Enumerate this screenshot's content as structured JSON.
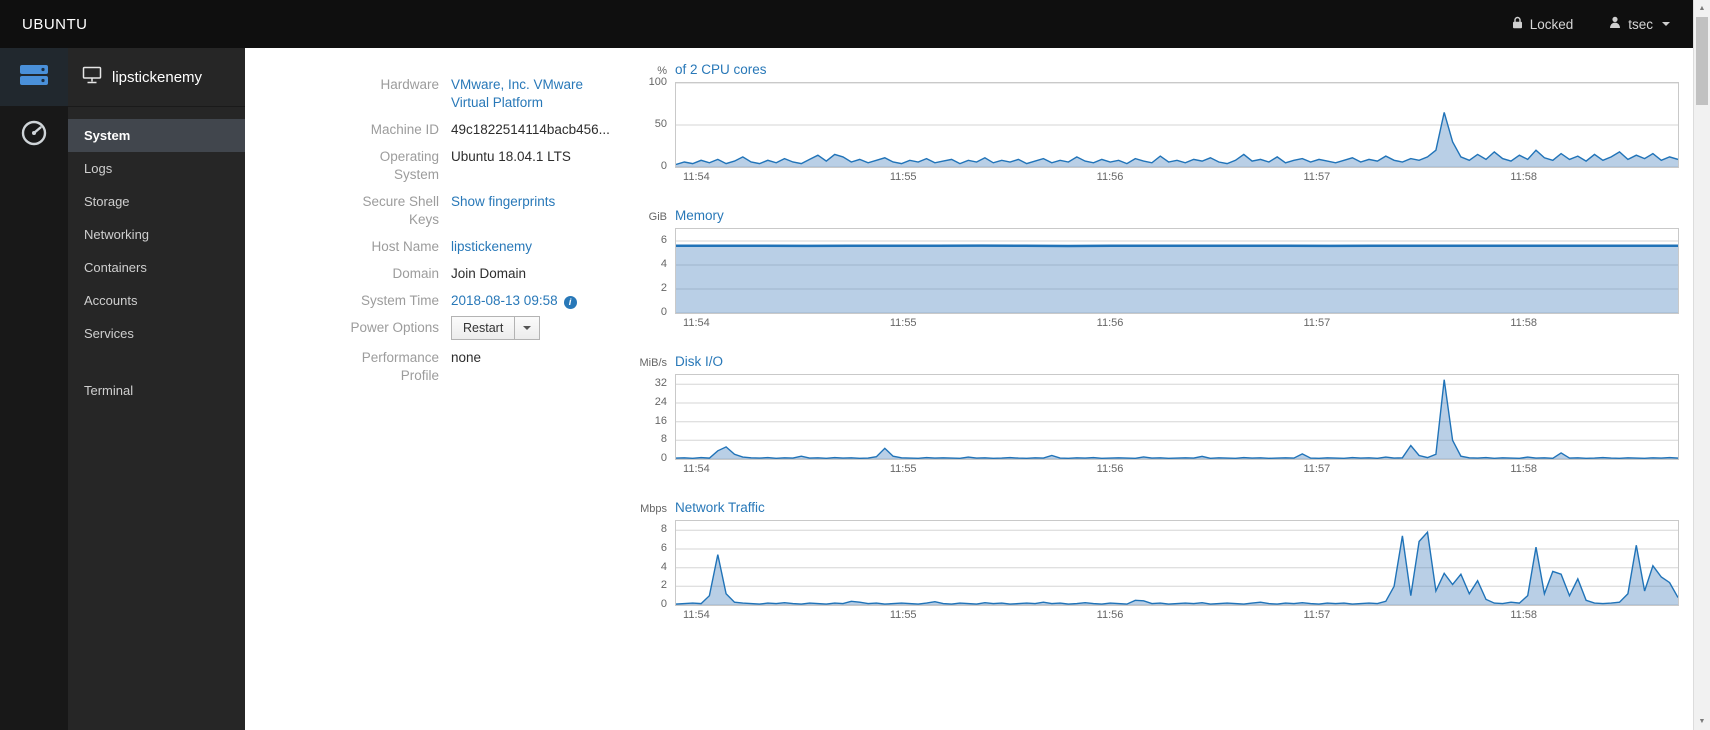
{
  "topbar": {
    "brand": "UBUNTU",
    "locked_label": "Locked",
    "user": "tsec"
  },
  "sidebar": {
    "host": "lipstickenemy",
    "items": [
      {
        "label": "System",
        "active": true
      },
      {
        "label": "Logs",
        "active": false
      },
      {
        "label": "Storage",
        "active": false
      },
      {
        "label": "Networking",
        "active": false
      },
      {
        "label": "Containers",
        "active": false
      },
      {
        "label": "Accounts",
        "active": false
      },
      {
        "label": "Services",
        "active": false
      },
      {
        "label": "Terminal",
        "active": false
      }
    ]
  },
  "system_info": {
    "fields": [
      {
        "label": "Hardware",
        "value": "VMware, Inc. VMware Virtual Platform"
      },
      {
        "label": "Machine ID",
        "value": "49c1822514114bacb456..."
      },
      {
        "label": "Operating System",
        "value": "Ubuntu 18.04.1 LTS"
      },
      {
        "label": "Secure Shell Keys",
        "value": "Show fingerprints"
      },
      {
        "label": "Host Name",
        "value": "lipstickenemy"
      },
      {
        "label": "Domain",
        "value": "Join Domain"
      },
      {
        "label": "System Time",
        "value": "2018-08-13 09:58"
      },
      {
        "label": "Power Options",
        "value": "Restart"
      },
      {
        "label": "Performance Profile",
        "value": "none"
      }
    ]
  },
  "colors": {
    "accent": "#2878b8",
    "chart_line": "#2073b8",
    "chart_fill": "rgba(70,130,190,0.38)",
    "sidebar_active_bg": "#41464d",
    "topbar_bg": "#0f0f0f"
  },
  "chart_data": [
    {
      "type": "area",
      "unit": "%",
      "title": "of 2 CPU cores",
      "ymax": 100,
      "yticks": [
        0,
        50,
        100
      ],
      "xticks": [
        "11:54",
        "11:55",
        "11:56",
        "11:57",
        "11:58"
      ],
      "xtick_pos": [
        0.008,
        0.214,
        0.42,
        0.626,
        0.832
      ],
      "line_width": 1.4,
      "values": [
        3,
        6,
        4,
        8,
        5,
        9,
        4,
        7,
        12,
        6,
        4,
        8,
        5,
        10,
        6,
        4,
        9,
        14,
        7,
        15,
        12,
        6,
        9,
        5,
        8,
        11,
        6,
        4,
        8,
        6,
        10,
        5,
        7,
        9,
        4,
        8,
        6,
        11,
        5,
        8,
        6,
        9,
        4,
        7,
        10,
        5,
        8,
        6,
        12,
        7,
        5,
        9,
        6,
        8,
        4,
        10,
        7,
        5,
        13,
        6,
        8,
        5,
        9,
        7,
        11,
        6,
        4,
        8,
        15,
        7,
        9,
        6,
        12,
        5,
        8,
        10,
        6,
        9,
        7,
        5,
        8,
        11,
        6,
        9,
        7,
        13,
        8,
        6,
        10,
        8,
        12,
        20,
        65,
        30,
        12,
        8,
        15,
        9,
        18,
        10,
        7,
        14,
        9,
        20,
        11,
        8,
        16,
        9,
        13,
        7,
        15,
        8,
        12,
        18,
        9,
        14,
        10,
        16,
        8,
        12,
        9
      ]
    },
    {
      "type": "area",
      "unit": "GiB",
      "title": "Memory",
      "ymax": 7,
      "yticks": [
        0,
        2,
        4,
        6
      ],
      "xticks": [
        "11:54",
        "11:55",
        "11:56",
        "11:57",
        "11:58"
      ],
      "xtick_pos": [
        0.008,
        0.214,
        0.42,
        0.626,
        0.832
      ],
      "line_width": 2.5,
      "values": [
        5.6,
        5.6,
        5.61,
        5.59,
        5.6,
        5.6,
        5.6,
        5.62,
        5.6,
        5.58,
        5.6,
        5.6,
        5.61,
        5.6,
        5.6,
        5.59,
        5.6,
        5.6,
        5.6,
        5.61,
        5.6,
        5.6,
        5.6,
        5.6
      ]
    },
    {
      "type": "area",
      "unit": "MiB/s",
      "title": "Disk I/O",
      "ymax": 36,
      "yticks": [
        0,
        8,
        16,
        24,
        32
      ],
      "xticks": [
        "11:54",
        "11:55",
        "11:56",
        "11:57",
        "11:58"
      ],
      "xtick_pos": [
        0.008,
        0.214,
        0.42,
        0.626,
        0.832
      ],
      "line_width": 1.4,
      "values": [
        0.4,
        0.5,
        0.3,
        0.6,
        0.4,
        3.5,
        5.2,
        2.0,
        0.8,
        0.5,
        0.4,
        0.6,
        0.3,
        0.5,
        0.4,
        1.2,
        0.4,
        0.5,
        0.3,
        0.6,
        0.4,
        0.5,
        0.3,
        0.4,
        1.0,
        4.6,
        1.2,
        0.5,
        0.4,
        0.3,
        0.6,
        0.4,
        0.5,
        0.4,
        0.3,
        0.8,
        0.4,
        0.5,
        0.3,
        0.4,
        0.6,
        0.4,
        0.3,
        0.5,
        0.4,
        1.5,
        0.4,
        0.3,
        0.5,
        0.4,
        0.6,
        0.3,
        0.4,
        0.5,
        0.4,
        0.3,
        0.9,
        0.4,
        0.5,
        0.3,
        0.4,
        0.5,
        0.4,
        1.1,
        0.3,
        0.5,
        0.4,
        0.3,
        0.6,
        0.4,
        0.5,
        0.3,
        0.4,
        0.5,
        0.4,
        2.2,
        0.4,
        0.3,
        0.5,
        0.4,
        0.3,
        0.6,
        0.4,
        0.5,
        0.3,
        0.8,
        0.4,
        0.5,
        5.8,
        1.5,
        0.6,
        2.0,
        34,
        8,
        1.2,
        0.5,
        0.4,
        0.6,
        0.3,
        0.5,
        0.4,
        0.3,
        0.8,
        0.4,
        0.5,
        0.3,
        2.6,
        0.4,
        0.5,
        0.3,
        0.4,
        0.6,
        0.4,
        0.3,
        0.5,
        0.4,
        0.3,
        0.5,
        0.4,
        0.6,
        0.4
      ]
    },
    {
      "type": "area",
      "unit": "Mbps",
      "title": "Network Traffic",
      "ymax": 9,
      "yticks": [
        0,
        2,
        4,
        6,
        8
      ],
      "xticks": [
        "11:54",
        "11:55",
        "11:56",
        "11:57",
        "11:58"
      ],
      "xtick_pos": [
        0.008,
        0.214,
        0.42,
        0.626,
        0.832
      ],
      "line_width": 1.4,
      "values": [
        0.1,
        0.15,
        0.2,
        0.15,
        1.0,
        5.4,
        1.2,
        0.3,
        0.2,
        0.15,
        0.1,
        0.2,
        0.15,
        0.25,
        0.15,
        0.1,
        0.2,
        0.15,
        0.1,
        0.2,
        0.15,
        0.4,
        0.3,
        0.15,
        0.2,
        0.1,
        0.15,
        0.2,
        0.15,
        0.1,
        0.2,
        0.35,
        0.15,
        0.1,
        0.2,
        0.15,
        0.1,
        0.25,
        0.15,
        0.2,
        0.1,
        0.15,
        0.2,
        0.15,
        0.3,
        0.15,
        0.2,
        0.1,
        0.15,
        0.25,
        0.15,
        0.1,
        0.2,
        0.15,
        0.1,
        0.5,
        0.45,
        0.15,
        0.2,
        0.1,
        0.15,
        0.2,
        0.15,
        0.25,
        0.1,
        0.15,
        0.2,
        0.15,
        0.1,
        0.2,
        0.3,
        0.15,
        0.1,
        0.2,
        0.15,
        0.25,
        0.15,
        0.1,
        0.2,
        0.15,
        0.2,
        0.1,
        0.15,
        0.2,
        0.15,
        0.4,
        2.0,
        7.4,
        1.0,
        6.8,
        7.8,
        1.5,
        3.4,
        2.2,
        3.3,
        1.2,
        2.6,
        0.6,
        0.2,
        0.15,
        0.3,
        0.2,
        1.0,
        6.2,
        1.2,
        3.6,
        3.3,
        1.0,
        2.8,
        0.5,
        0.2,
        0.15,
        0.2,
        0.3,
        1.2,
        6.4,
        1.5,
        4.2,
        3.0,
        2.4,
        0.8
      ]
    }
  ]
}
